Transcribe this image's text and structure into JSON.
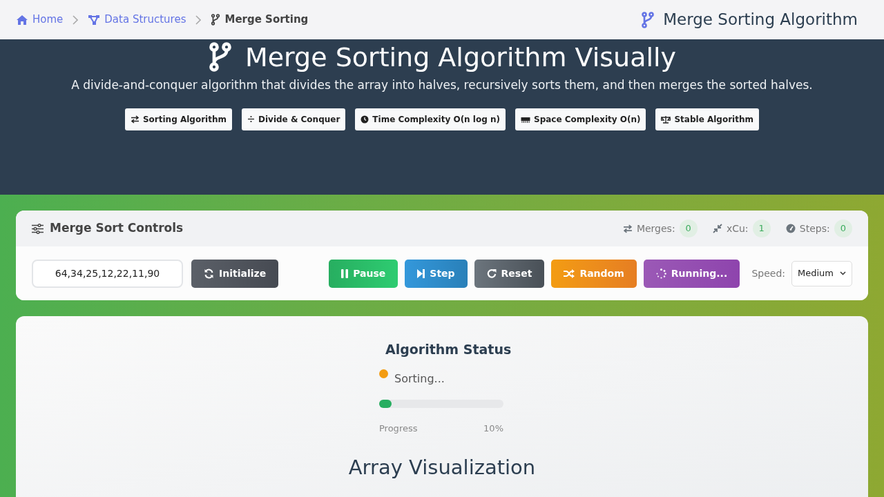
{
  "breadcrumb": [
    {
      "label": "Home",
      "current": false
    },
    {
      "label": "Data Structures",
      "current": false
    },
    {
      "label": "Merge Sorting",
      "current": true
    }
  ],
  "nav_title": "Merge Sorting Algorithm",
  "hero": {
    "title": "Merge Sorting Algorithm Visually",
    "subtitle": "A divide-and-conquer algorithm that divides the array into halves, recursively sorts them, and then merges the sorted halves.",
    "tags": [
      "Sorting Algorithm",
      "Divide & Conquer",
      "Time Complexity O(n log n)",
      "Space Complexity O(n)",
      "Stable Algorithm"
    ]
  },
  "controls": {
    "title": "Merge Sort Controls",
    "stats": [
      {
        "label": "Merges:",
        "value": "0"
      },
      {
        "label": "xCu:",
        "value": "1"
      },
      {
        "label": "Steps:",
        "value": "0"
      }
    ],
    "array_input": {
      "value": "64,34,25,12,22,11,90"
    },
    "buttons": [
      {
        "label": "Initialize",
        "kind": "dark"
      },
      {
        "label": "Pause",
        "kind": "success"
      },
      {
        "label": "Step",
        "kind": "info"
      },
      {
        "label": "Reset",
        "kind": "secondary"
      },
      {
        "label": "Random",
        "kind": "warning"
      },
      {
        "label": "Running...",
        "kind": "purple"
      }
    ],
    "speed": {
      "label": "Speed:",
      "value": "Medium"
    }
  },
  "status": {
    "title": "Algorithm Status",
    "state": "Sorting...",
    "color": "#f39c12",
    "level": 0.1,
    "progress_label": "Progress",
    "progress_value": "10%"
  },
  "visualization": {
    "title": "Array Visualization"
  }
}
